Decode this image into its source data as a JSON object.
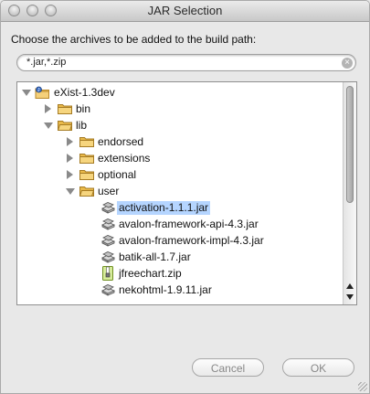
{
  "window": {
    "title": "JAR Selection"
  },
  "dialog": {
    "prompt": "Choose the archives to be added to the build path:",
    "filter_value": "*.jar,*.zip",
    "clear_glyph": "×"
  },
  "tree": {
    "items": [
      {
        "label": "eXist-1.3dev",
        "icon": "project-icon",
        "expanded": true,
        "depth": 0
      },
      {
        "label": "bin",
        "icon": "folder-icon",
        "expanded": false,
        "depth": 1
      },
      {
        "label": "lib",
        "icon": "folder-icon",
        "expanded": true,
        "depth": 1
      },
      {
        "label": "endorsed",
        "icon": "folder-icon",
        "expanded": false,
        "depth": 2
      },
      {
        "label": "extensions",
        "icon": "folder-icon",
        "expanded": false,
        "depth": 2
      },
      {
        "label": "optional",
        "icon": "folder-icon",
        "expanded": false,
        "depth": 2
      },
      {
        "label": "user",
        "icon": "folder-icon",
        "expanded": true,
        "depth": 2
      },
      {
        "label": "activation-1.1.1.jar",
        "icon": "jar-icon",
        "selected": true,
        "depth": 3
      },
      {
        "label": "avalon-framework-api-4.3.jar",
        "icon": "jar-icon",
        "depth": 3
      },
      {
        "label": "avalon-framework-impl-4.3.jar",
        "icon": "jar-icon",
        "depth": 3
      },
      {
        "label": "batik-all-1.7.jar",
        "icon": "jar-icon",
        "depth": 3
      },
      {
        "label": "jfreechart.zip",
        "icon": "zip-icon",
        "depth": 3
      },
      {
        "label": "nekohtml-1.9.11.jar",
        "icon": "jar-icon",
        "depth": 3
      }
    ]
  },
  "buttons": {
    "cancel_label": "Cancel",
    "ok_label": "OK"
  },
  "colors": {
    "selection": "#b5d5ff",
    "folder": "#e9b949"
  }
}
